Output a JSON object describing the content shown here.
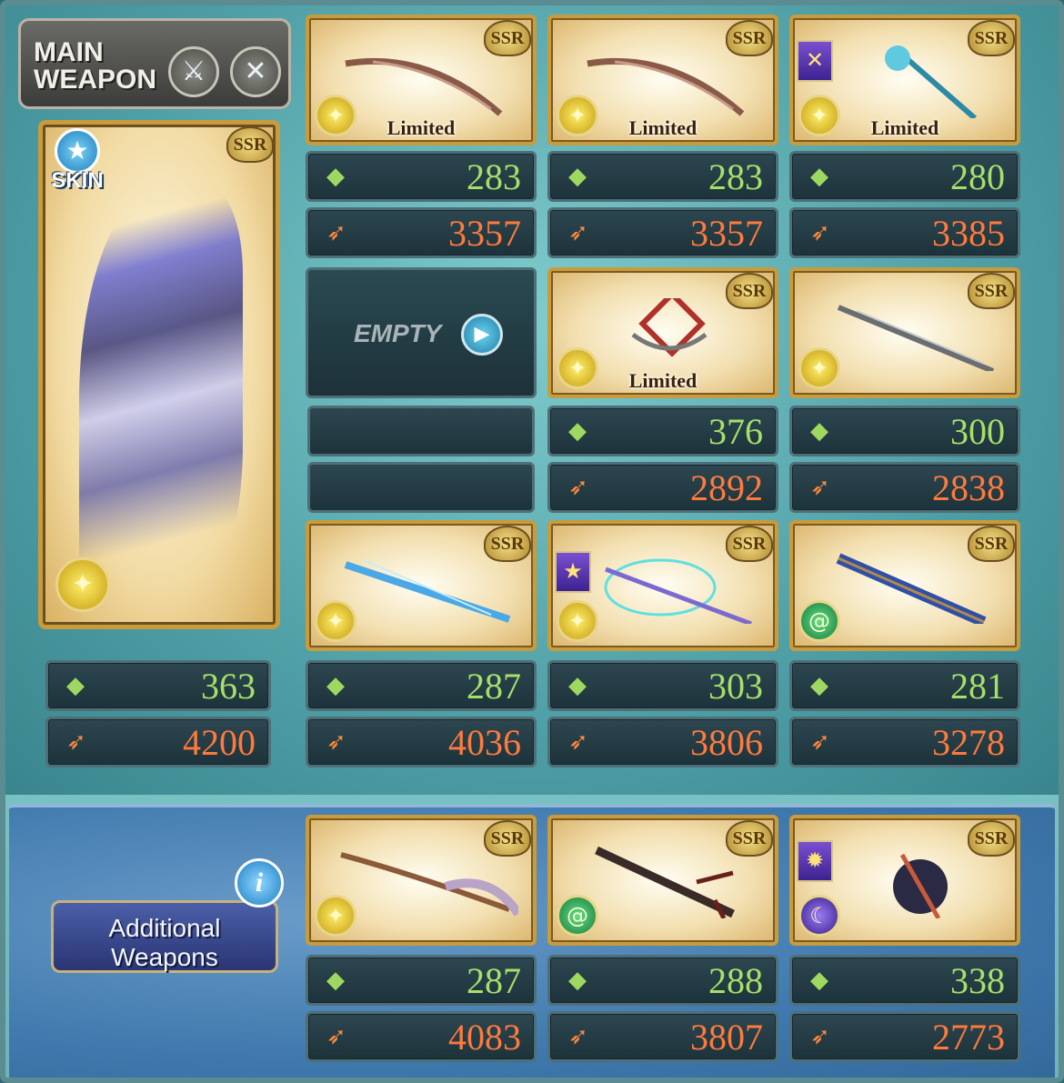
{
  "main_weapon": {
    "label_line1": "MAIN",
    "label_line2": "WEAPON",
    "skin_label": "SKIN",
    "rarity": "SSR",
    "element_icon": "light-icon",
    "hp": "363",
    "atk": "4200"
  },
  "grid": [
    {
      "rarity": "SSR",
      "element": "light",
      "limited": "Limited",
      "hp": "283",
      "atk": "3357"
    },
    {
      "rarity": "SSR",
      "element": "light",
      "limited": "Limited",
      "hp": "283",
      "atk": "3357"
    },
    {
      "rarity": "SSR",
      "element": "light",
      "limited": "Limited",
      "key_icon": "crossed-swords-icon",
      "hp": "280",
      "atk": "3385"
    },
    {
      "empty": true,
      "label": "EMPTY"
    },
    {
      "rarity": "SSR",
      "element": "light",
      "limited": "Limited",
      "hp": "376",
      "atk": "2892"
    },
    {
      "rarity": "SSR",
      "element": "light",
      "hp": "300",
      "atk": "2838"
    },
    {
      "rarity": "SSR",
      "element": "light",
      "hp": "287",
      "atk": "4036"
    },
    {
      "rarity": "SSR",
      "element": "light",
      "key_icon": "star-icon",
      "hp": "303",
      "atk": "3806"
    },
    {
      "rarity": "SSR",
      "element": "wind",
      "hp": "281",
      "atk": "3278"
    }
  ],
  "additional": {
    "label": "Additional Weapons",
    "label_line1": "Additional",
    "label_line2": "Weapons",
    "items": [
      {
        "rarity": "SSR",
        "element": "light",
        "hp": "287",
        "atk": "4083"
      },
      {
        "rarity": "SSR",
        "element": "wind",
        "hp": "288",
        "atk": "3807"
      },
      {
        "rarity": "SSR",
        "element": "dark",
        "key_icon": "burst-icon",
        "hp": "338",
        "atk": "2773"
      }
    ]
  },
  "colors": {
    "hp_text": "#a6e06a",
    "atk_text": "#ff7a3c",
    "card_border": "#c89b3c",
    "panel_top": "#5eb3b8",
    "panel_bottom": "#3f79ad"
  }
}
